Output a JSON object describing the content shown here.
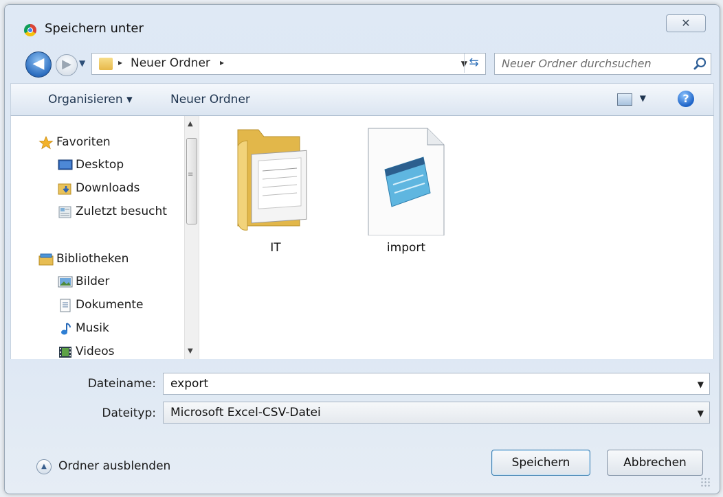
{
  "window": {
    "title": "Speichern unter",
    "close_glyph": "✕"
  },
  "nav": {
    "back_glyph": "◀",
    "forward_glyph": "▶"
  },
  "address": {
    "path": "Neuer Ordner",
    "arrow": "▸",
    "refresh_glyph": "⇆"
  },
  "search": {
    "placeholder": "Neuer Ordner durchsuchen"
  },
  "toolbar": {
    "organize_label": "Organisieren ▾",
    "new_folder_label": "Neuer Ordner",
    "help_glyph": "?"
  },
  "sidebar": {
    "favorites": {
      "label": "Favoriten",
      "items": [
        {
          "label": "Desktop",
          "icon": "desktop-icon"
        },
        {
          "label": "Downloads",
          "icon": "downloads-icon"
        },
        {
          "label": "Zuletzt besucht",
          "icon": "recent-places-icon"
        }
      ]
    },
    "libraries": {
      "label": "Bibliotheken",
      "items": [
        {
          "label": "Bilder",
          "icon": "pictures-icon"
        },
        {
          "label": "Dokumente",
          "icon": "documents-icon"
        },
        {
          "label": "Musik",
          "icon": "music-icon"
        },
        {
          "label": "Videos",
          "icon": "videos-icon"
        }
      ]
    }
  },
  "files": [
    {
      "name": "IT",
      "icon": "folder-icon"
    },
    {
      "name": "import",
      "icon": "notepad-file-icon"
    }
  ],
  "form": {
    "filename_label": "Dateiname:",
    "filename_value": "export",
    "filetype_label": "Dateityp:",
    "filetype_value": "Microsoft Excel-CSV-Datei"
  },
  "footer": {
    "hide_folders_label": "Ordner ausblenden",
    "save_label": "Speichern",
    "cancel_label": "Abbrechen"
  }
}
